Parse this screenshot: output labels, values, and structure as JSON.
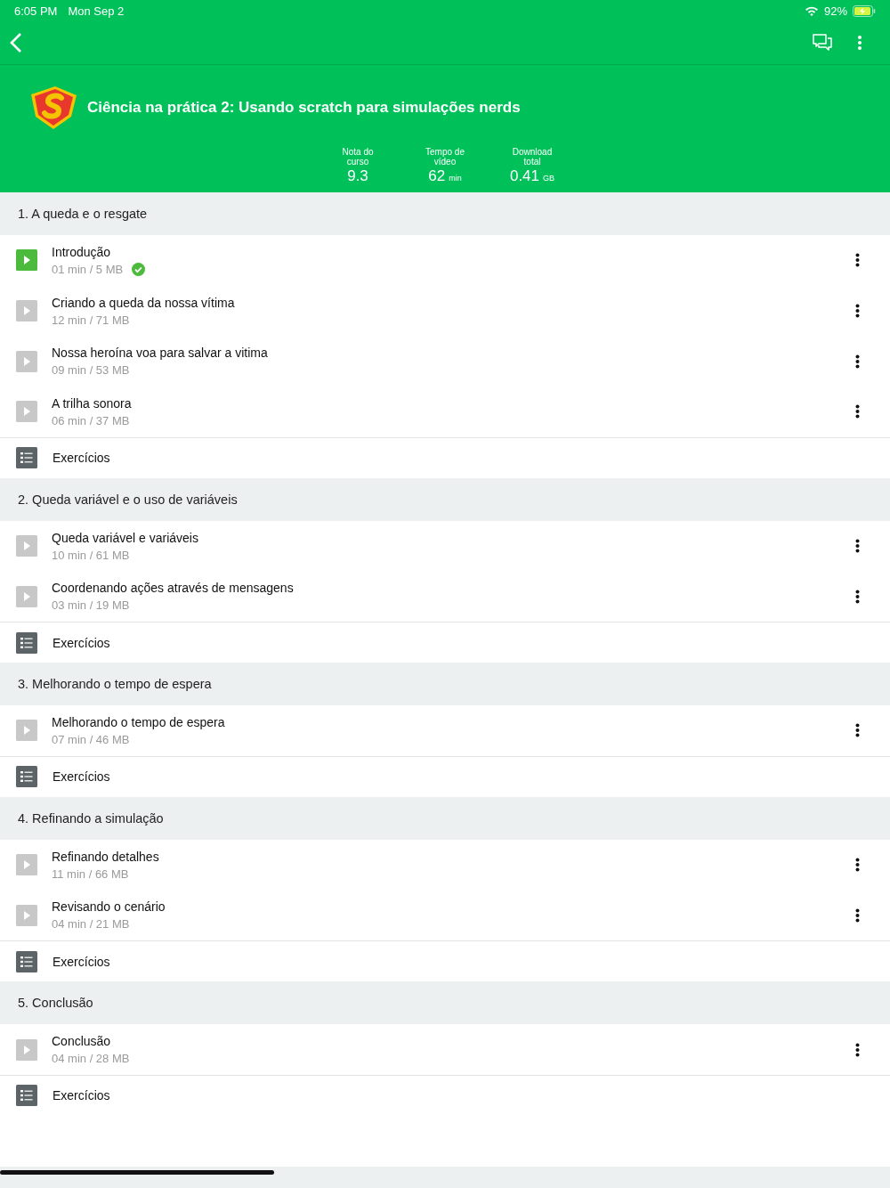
{
  "status_bar": {
    "time": "6:05 PM",
    "date": "Mon Sep 2",
    "battery": "92%"
  },
  "course": {
    "title": "Ciência na prática 2: Usando scratch para simulações nerds",
    "stats": [
      {
        "label": "Nota do curso",
        "value": "9.3"
      },
      {
        "label": "Tempo de vídeo",
        "value": "62",
        "unit": "min"
      },
      {
        "label": "Download total",
        "value": "0.41",
        "unit": "GB"
      }
    ]
  },
  "sections": [
    {
      "title": "1. A queda e o resgate",
      "items": [
        {
          "kind": "video",
          "title": "Introdução",
          "meta": "01 min / 5 MB",
          "watched": true
        },
        {
          "kind": "video",
          "title": "Criando a queda da nossa vítima",
          "meta": "12 min / 71 MB",
          "watched": false
        },
        {
          "kind": "video",
          "title": "Nossa heroína voa para salvar a vitima",
          "meta": "09 min / 53 MB",
          "watched": false
        },
        {
          "kind": "video",
          "title": "A trilha sonora",
          "meta": "06 min / 37 MB",
          "watched": false
        },
        {
          "kind": "exercise",
          "title": "Exercícios"
        }
      ]
    },
    {
      "title": "2. Queda variável e o uso de variáveis",
      "items": [
        {
          "kind": "video",
          "title": "Queda variável e variáveis",
          "meta": "10 min / 61 MB",
          "watched": false
        },
        {
          "kind": "video",
          "title": "Coordenando ações através de mensagens",
          "meta": "03 min / 19 MB",
          "watched": false
        },
        {
          "kind": "exercise",
          "title": "Exercícios"
        }
      ]
    },
    {
      "title": "3. Melhorando o tempo de espera",
      "items": [
        {
          "kind": "video",
          "title": "Melhorando o tempo de espera",
          "meta": "07 min / 46 MB",
          "watched": false
        },
        {
          "kind": "exercise",
          "title": "Exercícios"
        }
      ]
    },
    {
      "title": "4. Refinando a simulação",
      "items": [
        {
          "kind": "video",
          "title": "Refinando detalhes",
          "meta": "11 min / 66 MB",
          "watched": false
        },
        {
          "kind": "video",
          "title": "Revisando o cenário",
          "meta": "04 min / 21 MB",
          "watched": false
        },
        {
          "kind": "exercise",
          "title": "Exercícios"
        }
      ]
    },
    {
      "title": "5. Conclusão",
      "items": [
        {
          "kind": "video",
          "title": "Conclusão",
          "meta": "04 min / 28 MB",
          "watched": false
        },
        {
          "kind": "exercise",
          "title": "Exercícios"
        }
      ]
    }
  ]
}
